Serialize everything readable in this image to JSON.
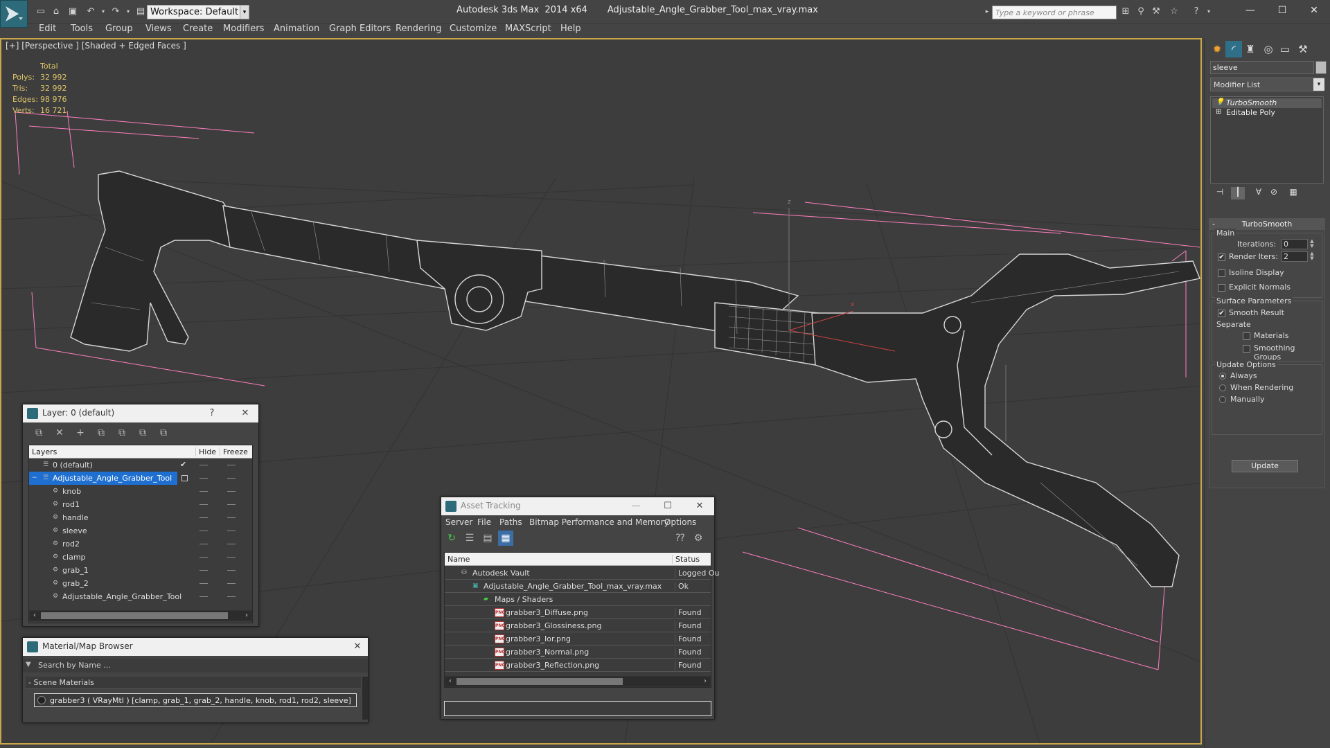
{
  "titlebar": {
    "workspace": "Workspace: Default",
    "app_title": "Autodesk 3ds Max  2014 x64       Adjustable_Angle_Grabber_Tool_max_vray.max",
    "search_placeholder": "Type a keyword or phrase"
  },
  "menu": [
    "Edit",
    "Tools",
    "Group",
    "Views",
    "Create",
    "Modifiers",
    "Animation",
    "Graph Editors",
    "Rendering",
    "Customize",
    "MAXScript",
    "Help"
  ],
  "viewport": {
    "label": "[+] [Perspective ] [Shaded + Edged Faces ]",
    "stats": {
      "header": "Total",
      "polys_label": "Polys:",
      "polys": "32 992",
      "tris_label": "Tris:",
      "tris": "32 992",
      "edges_label": "Edges:",
      "edges": "98 976",
      "verts_label": "Verts:",
      "verts": "16 721"
    },
    "axis_z": "z",
    "axis_x": "x"
  },
  "command_panel": {
    "object_name": "sleeve",
    "modifier_list": "Modifier List",
    "stack": [
      "TurboSmooth",
      "Editable Poly"
    ],
    "turbosmooth": {
      "title": "TurboSmooth",
      "main": "Main",
      "iterations_label": "Iterations:",
      "iterations": "0",
      "render_iters_label": "Render Iters:",
      "render_iters": "2",
      "isoline": "Isoline Display",
      "explicit_normals": "Explicit Normals",
      "surface_params": "Surface Parameters",
      "smooth_result": "Smooth Result",
      "separate": "Separate",
      "materials": "Materials",
      "smoothing_groups": "Smoothing Groups",
      "update_options": "Update Options",
      "always": "Always",
      "when_rendering": "When Rendering",
      "manually": "Manually",
      "update_button": "Update"
    }
  },
  "layer_dialog": {
    "title": "Layer: 0 (default)",
    "help": "?",
    "col_layers": "Layers",
    "col_hide": "Hide",
    "col_freeze": "Freeze",
    "rows": [
      "0 (default)",
      "Adjustable_Angle_Grabber_Tool",
      "knob",
      "rod1",
      "handle",
      "sleeve",
      "rod2",
      "clamp",
      "grab_1",
      "grab_2",
      "Adjustable_Angle_Grabber_Tool"
    ]
  },
  "asset_tracking": {
    "title": "Asset Tracking",
    "menu": [
      "Server",
      "File",
      "Paths",
      "Bitmap Performance and Memory",
      "Options"
    ],
    "col_name": "Name",
    "col_status": "Status",
    "rows": [
      {
        "name": "Autodesk Vault",
        "status": "Logged Ou"
      },
      {
        "name": "Adjustable_Angle_Grabber_Tool_max_vray.max",
        "status": "Ok"
      },
      {
        "name": "Maps / Shaders",
        "status": ""
      },
      {
        "name": "grabber3_Diffuse.png",
        "status": "Found"
      },
      {
        "name": "grabber3_Glossiness.png",
        "status": "Found"
      },
      {
        "name": "grabber3_Ior.png",
        "status": "Found"
      },
      {
        "name": "grabber3_Normal.png",
        "status": "Found"
      },
      {
        "name": "grabber3_Reflection.png",
        "status": "Found"
      }
    ]
  },
  "material_browser": {
    "title": "Material/Map Browser",
    "search_placeholder": "Search by Name ...",
    "section": "- Scene Materials",
    "item": "grabber3  ( VRayMtl )  [clamp, grab_1, grab_2, handle, knob, rod1, rod2, sleeve]"
  }
}
